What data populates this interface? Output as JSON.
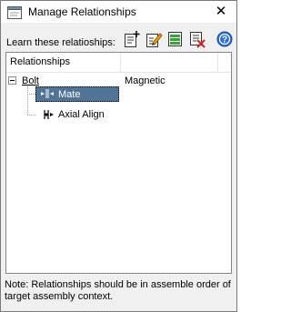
{
  "window": {
    "title": "Manage Relationships",
    "close_glyph": "✕"
  },
  "toolbar": {
    "label": "Learn these relatioships:",
    "buttons": [
      {
        "icon": "add-relationship-icon"
      },
      {
        "icon": "edit-relationship-icon"
      },
      {
        "icon": "list-relationship-icon"
      },
      {
        "icon": "delete-relationship-icon"
      },
      {
        "icon": "help-icon"
      }
    ]
  },
  "list": {
    "column_header": "Relationships",
    "root": {
      "label": "Bolt",
      "value": "Magnetic",
      "expanded": true
    },
    "children": [
      {
        "label": "Mate",
        "selected": true,
        "icon": "mate-icon"
      },
      {
        "label": "Axial Align",
        "selected": false,
        "icon": "axial-align-icon"
      }
    ]
  },
  "note": "Note: Relationships should be in assemble order of target assembly context.",
  "colors": {
    "selection": "#517396",
    "window_bg": "#f0f0f0"
  }
}
